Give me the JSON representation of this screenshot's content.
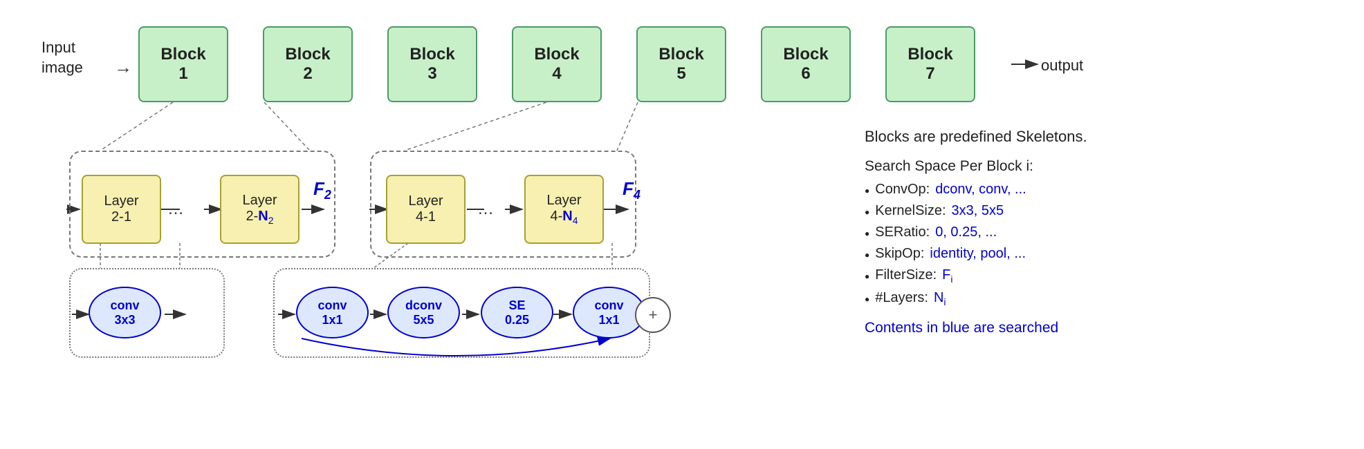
{
  "pipeline": {
    "input_label": "Input\nimage",
    "output_label": "output",
    "blocks": [
      {
        "label": "Block",
        "number": "1"
      },
      {
        "label": "Block",
        "number": "2"
      },
      {
        "label": "Block",
        "number": "3"
      },
      {
        "label": "Block",
        "number": "4"
      },
      {
        "label": "Block",
        "number": "5"
      },
      {
        "label": "Block",
        "number": "6"
      },
      {
        "label": "Block",
        "number": "7"
      }
    ]
  },
  "block2_expansion": {
    "layer1": {
      "line1": "Layer",
      "line2": "2-1"
    },
    "layer2_line1": "Layer",
    "layer2_line2": "2-",
    "layer2_n": "N",
    "layer2_sub": "2",
    "f_label": "F",
    "f_sub": "2"
  },
  "block4_expansion": {
    "layer1": {
      "line1": "Layer",
      "line2": "4-1"
    },
    "layer2_line1": "Layer",
    "layer2_line2": "4-",
    "layer2_n": "N",
    "layer2_sub": "4",
    "f_label": "F",
    "f_sub": "4"
  },
  "layer2_detail": {
    "oval": {
      "line1": "conv",
      "line2": "3x3"
    }
  },
  "layer4_detail": {
    "ovals": [
      {
        "line1": "conv",
        "line2": "1x1"
      },
      {
        "line1": "dconv",
        "line2": "5x5"
      },
      {
        "line1": "SE",
        "line2": "0.25"
      },
      {
        "line1": "conv",
        "line2": "1x1"
      }
    ],
    "plus": "+"
  },
  "right_panel": {
    "title": "Blocks are predefined Skeletons.",
    "search_space_title": "Search Space Per Block i:",
    "items": [
      {
        "label": "ConvOp:",
        "values": "dconv, conv, ...",
        "has_blue": true
      },
      {
        "label": "KernelSize:",
        "values": "3x3, 5x5",
        "has_blue": true
      },
      {
        "label": "SERatio:",
        "values": "0, 0.25, ...",
        "has_blue": true
      },
      {
        "label": "SkipOp:",
        "values": "identity, pool, ...",
        "has_blue": true
      },
      {
        "label": "FilterSize:",
        "values": "F",
        "sub": "i",
        "has_blue": true
      },
      {
        "label": "#Layers:",
        "values": "N",
        "sub": "i",
        "has_blue": true
      }
    ],
    "footer": "Contents in blue are searched"
  }
}
